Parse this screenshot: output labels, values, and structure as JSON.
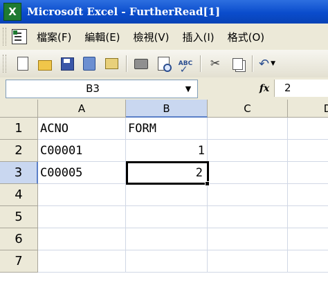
{
  "window": {
    "title": "Microsoft Excel - FurtherRead[1]",
    "app_icon_letter": "X"
  },
  "menu": {
    "items": [
      "檔案(F)",
      "編輯(E)",
      "檢視(V)",
      "插入(I)",
      "格式(O)"
    ]
  },
  "toolbar": {
    "buttons": [
      "new-icon",
      "open-icon",
      "save-icon",
      "permission-icon",
      "email-icon",
      "print-icon",
      "print-preview-icon",
      "spelling-icon",
      "cut-icon",
      "copy-icon",
      "undo-icon"
    ],
    "spell_label": "ABC"
  },
  "formula_bar": {
    "name_box": "B3",
    "fx_label": "fx",
    "value": "2"
  },
  "grid": {
    "columns": [
      "A",
      "B",
      "C",
      "D"
    ],
    "rows": [
      "1",
      "2",
      "3",
      "4",
      "5",
      "6",
      "7"
    ],
    "cells": {
      "A1": "ACNO",
      "B1": "FORM",
      "A2": "C00001",
      "B2": "1",
      "A3": "C00005",
      "B3": "2"
    },
    "active_cell": "B3",
    "active_column": "B",
    "active_row": "3"
  },
  "colors": {
    "titlebar": "#0a4ccc",
    "chrome": "#ece9d8",
    "header_highlight": "#c9d7f0",
    "gridline": "#d0d7e5"
  }
}
